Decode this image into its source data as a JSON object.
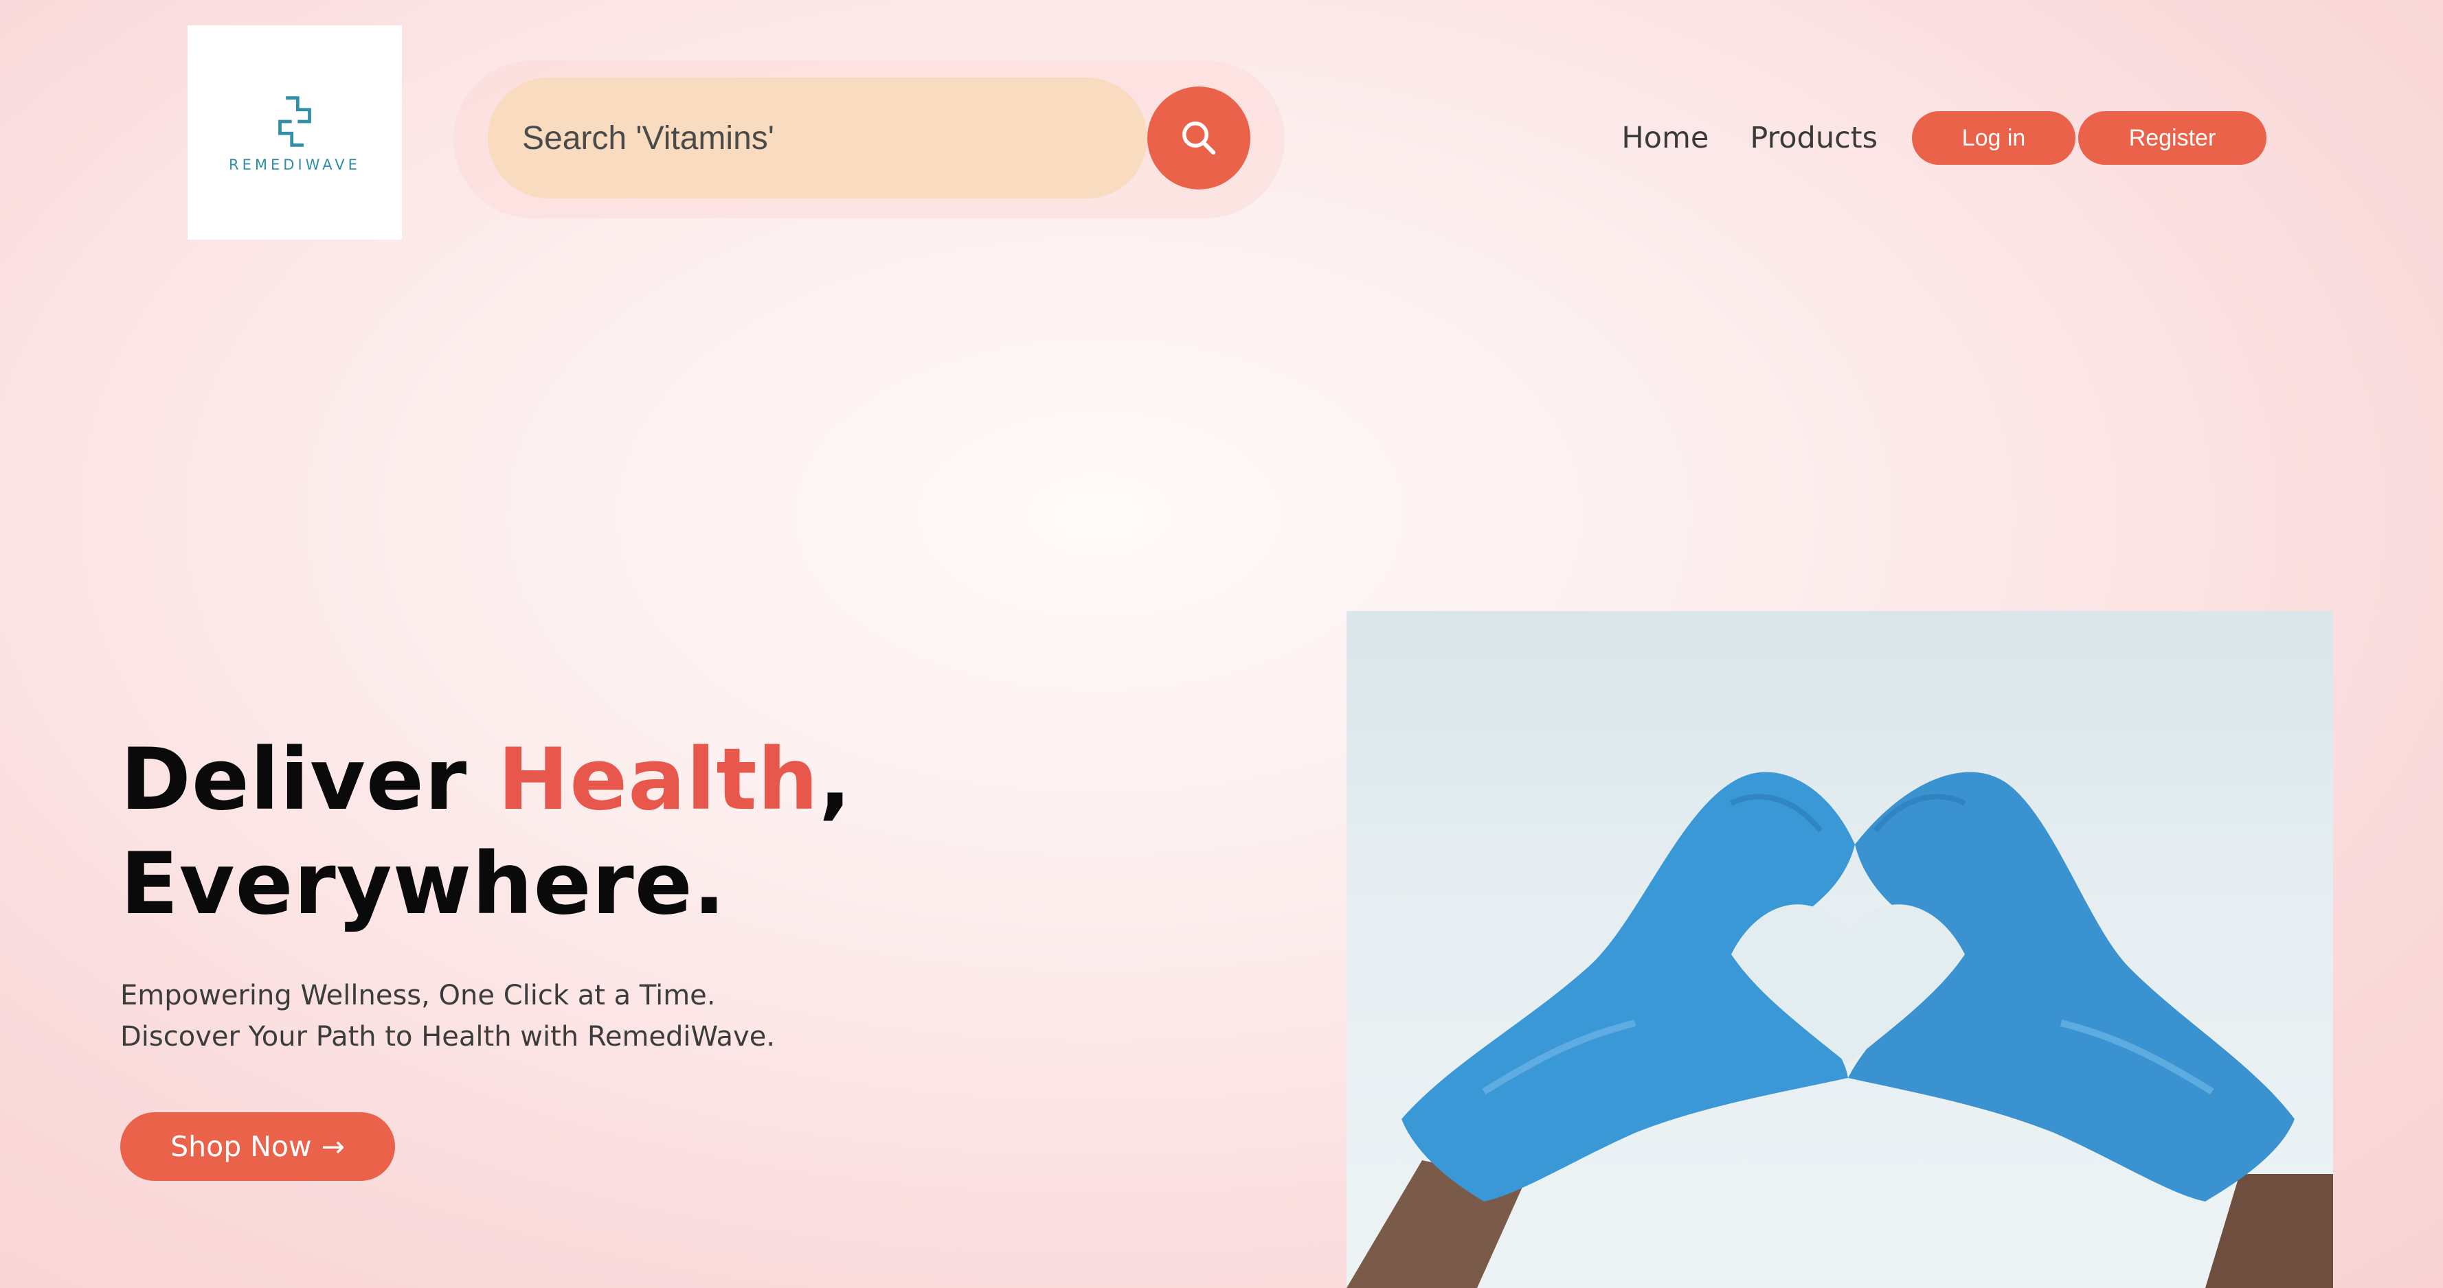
{
  "header": {
    "logo": {
      "text": "REMEDIWAVE",
      "icon": "medical-cross-icon",
      "color": "#2f8fa6"
    },
    "search": {
      "placeholder": "Search 'Vitamins'",
      "button_icon": "search-icon"
    },
    "nav": {
      "home": "Home",
      "products": "Products",
      "login": "Log in",
      "register": "Register"
    }
  },
  "hero": {
    "title_part1": "Deliver ",
    "title_accent": "Health",
    "title_part2": ",",
    "title_line2": "Everywhere.",
    "subtitle_line1": "Empowering Wellness, One Click at a Time.",
    "subtitle_line2": "Discover Your Path to Health with RemediWave.",
    "cta_label": "Shop Now",
    "cta_icon": "arrow-right-icon",
    "image_description_icon": "gloved-hands-heart-photo"
  },
  "colors": {
    "accent": "#eb624a",
    "title_accent": "#e8574b",
    "search_bg": "#f9dcbf",
    "text_dark": "#0a0a0a"
  }
}
